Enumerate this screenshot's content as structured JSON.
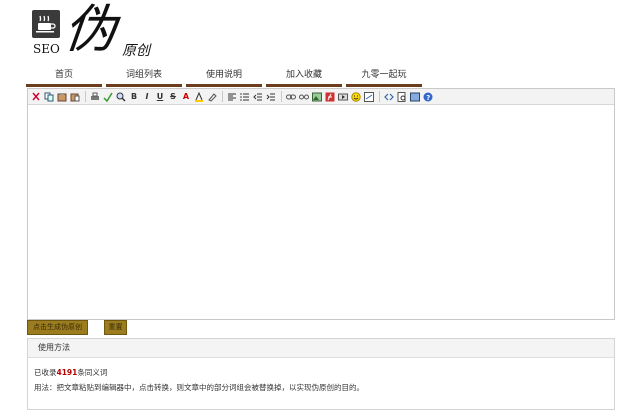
{
  "logo": {
    "seo_text": "SEO",
    "big_char": "伪",
    "small_chars": "原创"
  },
  "nav": [
    {
      "label": "首页"
    },
    {
      "label": "词组列表"
    },
    {
      "label": "使用说明"
    },
    {
      "label": "加入收藏"
    },
    {
      "label": "九零一起玩"
    }
  ],
  "toolbar": {
    "icons": [
      "cut-icon",
      "copy-icon",
      "paste-icon",
      "paste-text-icon",
      "sep",
      "print-icon",
      "spellcheck-icon",
      "find-replace-icon",
      "bold-icon",
      "italic-icon",
      "underline-icon",
      "strike-icon",
      "font-color-icon",
      "bg-color-icon",
      "remove-format-icon",
      "sep",
      "align-left-icon",
      "list-icon",
      "outdent-icon",
      "indent-icon",
      "sep",
      "link-icon",
      "unlink-icon",
      "image-icon",
      "flash-icon",
      "media-icon",
      "emoticon-icon",
      "special-char-icon",
      "sep",
      "source-icon",
      "preview-icon",
      "fullscreen-icon",
      "help-icon"
    ],
    "bold_glyph": "B",
    "italic_glyph": "I",
    "underline_glyph": "U",
    "strike_glyph": "S",
    "font_color_glyph": "A"
  },
  "buttons": {
    "generate": "点击生成伪原创",
    "reset": "重置"
  },
  "usage": {
    "title": "使用方法",
    "line1_prefix": "已收录",
    "line1_count": "4191",
    "line1_suffix": "条同义词",
    "line2": "用法：把文章粘贴到编辑器中，点击转换，则文章中的部分词组会被替换掉，以实现伪原创的目的。"
  }
}
